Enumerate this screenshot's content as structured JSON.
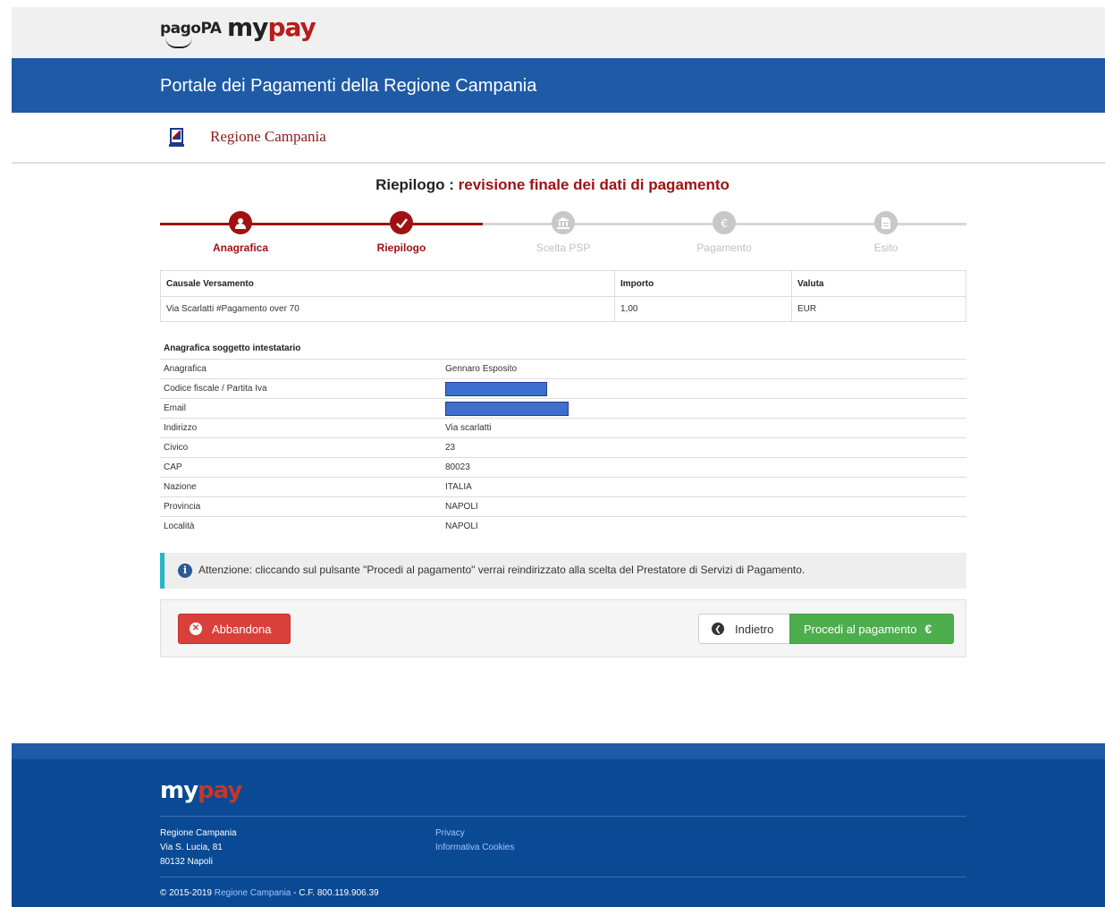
{
  "header": {
    "logo_pagopa": "pagoPA",
    "logo_mypay_my": "my",
    "logo_mypay_pay": "pay",
    "portal_title": "Portale dei Pagamenti della Regione Campania",
    "entity_name": "Regione Campania"
  },
  "page": {
    "title_prefix": "Riepilogo :",
    "title_suffix": "revisione finale dei dati di pagamento"
  },
  "steps": [
    {
      "label": "Anagrafica",
      "icon": "user-icon",
      "active": true
    },
    {
      "label": "Riepilogo",
      "icon": "check-icon",
      "active": true
    },
    {
      "label": "Scelta PSP",
      "icon": "bank-icon",
      "active": false
    },
    {
      "label": "Pagamento",
      "icon": "euro-icon",
      "active": false
    },
    {
      "label": "Esito",
      "icon": "document-icon",
      "active": false
    }
  ],
  "payment_table": {
    "headers": [
      "Causale Versamento",
      "Importo",
      "Valuta"
    ],
    "row": [
      "Via Scarlatti #Pagamento over 70",
      "1,00",
      "EUR"
    ]
  },
  "anagrafica": {
    "title": "Anagrafica soggetto intestatario",
    "rows": [
      {
        "key": "Anagrafica",
        "value": "Gennaro Esposito"
      },
      {
        "key": "Codice fiscale / Partita Iva",
        "value": ""
      },
      {
        "key": "Email",
        "value": ""
      },
      {
        "key": "Indirizzo",
        "value": "Via scarlatti"
      },
      {
        "key": "Civico",
        "value": "23"
      },
      {
        "key": "CAP",
        "value": "80023"
      },
      {
        "key": "Nazione",
        "value": "ITALIA"
      },
      {
        "key": "Provincia",
        "value": "NAPOLI"
      },
      {
        "key": "Località",
        "value": "NAPOLI"
      }
    ]
  },
  "alert": {
    "text": "Attenzione: cliccando sul pulsante \"Procedi al pagamento\" verrai reindirizzato alla scelta del Prestatore di Servizi di Pagamento."
  },
  "actions": {
    "abandon_label": "Abbandona",
    "back_label": "Indietro",
    "proceed_label": "Procedi al pagamento",
    "proceed_symbol": "€"
  },
  "footer": {
    "logo_my": "my",
    "logo_pay": "pay",
    "address_line1": "Regione Campania",
    "address_line2": "Via S. Lucia, 81",
    "address_line3": "80132 Napoli",
    "link_privacy": "Privacy",
    "link_cookies": "Informativa Cookies",
    "copyright_prefix": "© 2015-2019",
    "copyright_link": "Regione Campania",
    "copyright_suffix": "- C.F. 800.119.906.39"
  },
  "colors": {
    "brand_blue": "#1f5aa6",
    "accent_red": "#a01212",
    "success_green": "#4cae4c",
    "danger_red": "#d9403a"
  }
}
